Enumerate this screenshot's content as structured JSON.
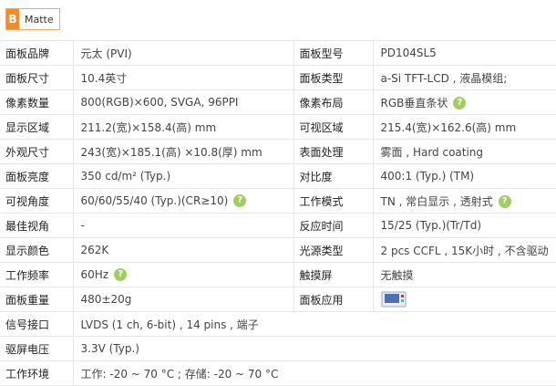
{
  "badge": {
    "letter": "B",
    "label": "Matte"
  },
  "rows": [
    {
      "k1": "面板品牌",
      "v1": "元太 (PVI)",
      "k2": "面板型号",
      "v2": "PD104SL5"
    },
    {
      "k1": "面板尺寸",
      "v1": "10.4英寸",
      "k2": "面板类型",
      "v2": "a-Si TFT-LCD , 液晶模组;"
    },
    {
      "k1": "像素数量",
      "v1": "800(RGB)×600, SVGA, 96PPI",
      "k2": "像素布局",
      "v2": "RGB垂直条状"
    },
    {
      "k1": "显示区域",
      "v1": "211.2(宽)×158.4(高) mm",
      "k2": "可视区域",
      "v2": "215.4(宽)×162.6(高) mm"
    },
    {
      "k1": "外观尺寸",
      "v1": "243(宽)×185.1(高) ×10.8(厚) mm",
      "k2": "表面处理",
      "v2": "雾面 , Hard coating"
    },
    {
      "k1": "面板亮度",
      "v1": "350 cd/m² (Typ.)",
      "k2": "对比度",
      "v2": "400:1 (Typ.) (TM)"
    },
    {
      "k1": "可视角度",
      "v1": "60/60/55/40 (Typ.)(CR≥10)",
      "k2": "工作模式",
      "v2": "TN , 常白显示 , 透射式"
    },
    {
      "k1": "最佳视角",
      "v1": "-",
      "k2": "反应时间",
      "v2": "15/25 (Typ.)(Tr/Td)"
    },
    {
      "k1": "显示颜色",
      "v1": "262K",
      "k2": "光源类型",
      "v2": "2 pcs CCFL , 15K小时 , 不含驱动"
    },
    {
      "k1": "工作频率",
      "v1": "60Hz",
      "k2": "触摸屏",
      "v2": "无触摸"
    },
    {
      "k1": "面板重量",
      "v1": "480±20g",
      "k2": "面板应用",
      "v2": ""
    },
    {
      "k1": "信号接口",
      "v1": "LVDS (1 ch, 6-bit) , 14 pins , 端子"
    },
    {
      "k1": "驱屏电压",
      "v1": "3.3V (Typ.)"
    },
    {
      "k1": "工作环境",
      "v1": "工作: -20 ~ 70 °C ; 存储: -20 ~ 70 °C"
    }
  ],
  "help_icon_glyph": "?"
}
